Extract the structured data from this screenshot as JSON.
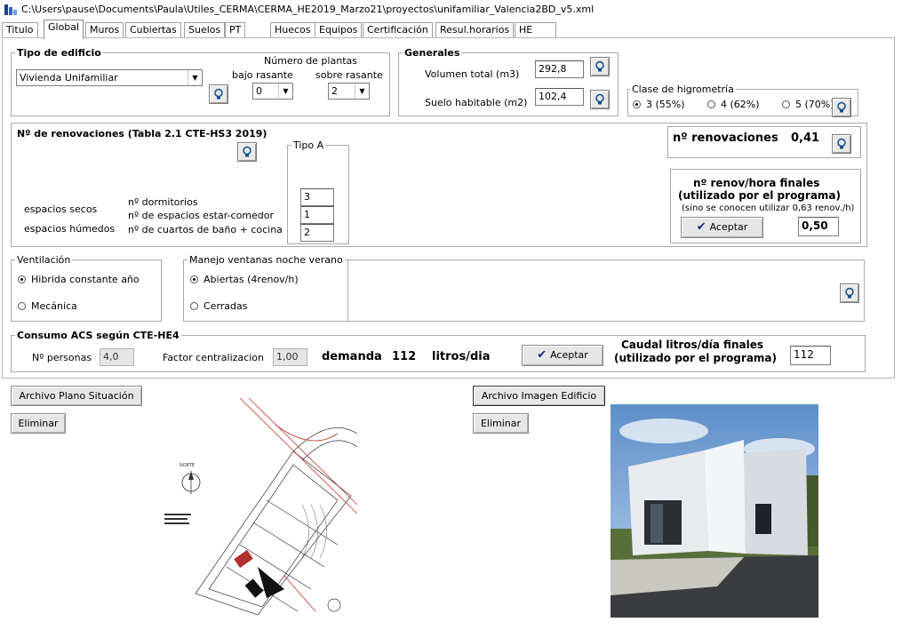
{
  "window": {
    "title": "C:\\Users\\pause\\Documents\\Paula\\Utiles_CERMA\\CERMA_HE2019_Marzo21\\proyectos\\unifamiliar_Valencia2BD_v5.xml"
  },
  "tabs": [
    "Titulo",
    "Global",
    "Muros",
    "Cubiertas",
    "Suelos",
    "PT",
    "Huecos",
    "Equipos",
    "Certificación",
    "Resul.horarios",
    "HE"
  ],
  "tipo_edificio": {
    "title": "Tipo de edificio",
    "value": "Vivienda Unifamiliar",
    "plantas_label": "Número de plantas",
    "bajo_label": "bajo rasante",
    "sobre_label": "sobre rasante",
    "bajo_value": "0",
    "sobre_value": "2"
  },
  "generales": {
    "title": "Generales",
    "volumen_label": "Volumen total (m3)",
    "volumen_value": "292,8",
    "suelo_label": "Suelo habitable (m2)",
    "suelo_value": "102,4"
  },
  "higrometria": {
    "title": "Clase de higrometría",
    "options": [
      "3 (55%)",
      "4 (62%)",
      "5 (70%)"
    ],
    "selected": 0
  },
  "renovaciones": {
    "title": "Nº de renovaciones (Tabla 2.1 CTE-HS3 2019)",
    "tipo_title": "Tipo A",
    "secos_label": "espacios secos",
    "humedos_label": "espacios húmedos",
    "dormitorios_label": "nº dormitorios",
    "estar_label": "nº de espacios estar-comedor",
    "banos_label": "nº de cuartos de baño + cocina",
    "dormitorios_value": "3",
    "estar_value": "1",
    "banos_value": "2",
    "nren_label": "nº renovaciones",
    "nren_value": "0,41",
    "final_title_1": "nº renov/hora finales",
    "final_title_2": "(utilizado por el programa)",
    "final_note": "(sino se conocen utilizar 0,63 renov./h)",
    "accept_label": "Aceptar",
    "final_value": "0,50"
  },
  "ventilacion": {
    "title": "Ventilación",
    "options": [
      "Hibrida constante año",
      "Mecánica"
    ],
    "selected": 0
  },
  "ventanas": {
    "title": "Manejo ventanas noche verano",
    "options": [
      "Abiertas (4renov/h)",
      "Cerradas"
    ],
    "selected": 0
  },
  "acs": {
    "title": "Consumo ACS según CTE-HE4",
    "personas_label": "Nº personas",
    "personas_value": "4,0",
    "factor_label": "Factor centralizacion",
    "factor_value": "1,00",
    "demanda_label": "demanda",
    "demanda_value": "112",
    "demanda_unit": "litros/dia",
    "accept_label": "Aceptar",
    "caudal_title_1": "Caudal litros/día finales",
    "caudal_title_2": "(utilizado por el programa)",
    "caudal_value": "112"
  },
  "files": {
    "plano_button": "Archivo Plano Situación",
    "plano_delete": "Eliminar",
    "imagen_button": "Archivo Imagen Edificio",
    "imagen_delete": "Eliminar",
    "plano_north_label": "NORTE"
  },
  "icons": {
    "help": "lightbulb-icon",
    "accept": "checkmark-icon",
    "app": "app-icon"
  }
}
